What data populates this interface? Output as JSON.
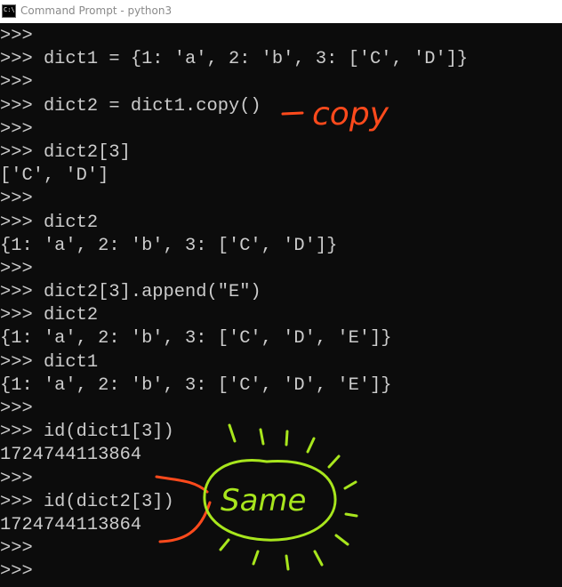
{
  "window": {
    "title": "Command Prompt - python3",
    "icon": "console-app-icon",
    "icon_label": "C:\\"
  },
  "console": {
    "lines": [
      ">>>",
      ">>> dict1 = {1: 'a', 2: 'b', 3: ['C', 'D']}",
      ">>>",
      ">>> dict2 = dict1.copy()",
      ">>>",
      ">>> dict2[3]",
      "['C', 'D']",
      ">>>",
      ">>> dict2",
      "{1: 'a', 2: 'b', 3: ['C', 'D']}",
      ">>>",
      ">>> dict2[3].append(\"E\")",
      ">>> dict2",
      "{1: 'a', 2: 'b', 3: ['C', 'D', 'E']}",
      ">>> dict1",
      "{1: 'a', 2: 'b', 3: ['C', 'D', 'E']}",
      ">>>",
      ">>> id(dict1[3])",
      "1724744113864",
      ">>>",
      ">>> id(dict2[3])",
      "1724744113864",
      ">>>",
      ">>>"
    ]
  },
  "annotations": {
    "copy_note": "copy",
    "same_note": "Same",
    "copy_color": "#ff4a1c",
    "arrow_color": "#ff4a1c",
    "same_color": "#a8e61d"
  }
}
